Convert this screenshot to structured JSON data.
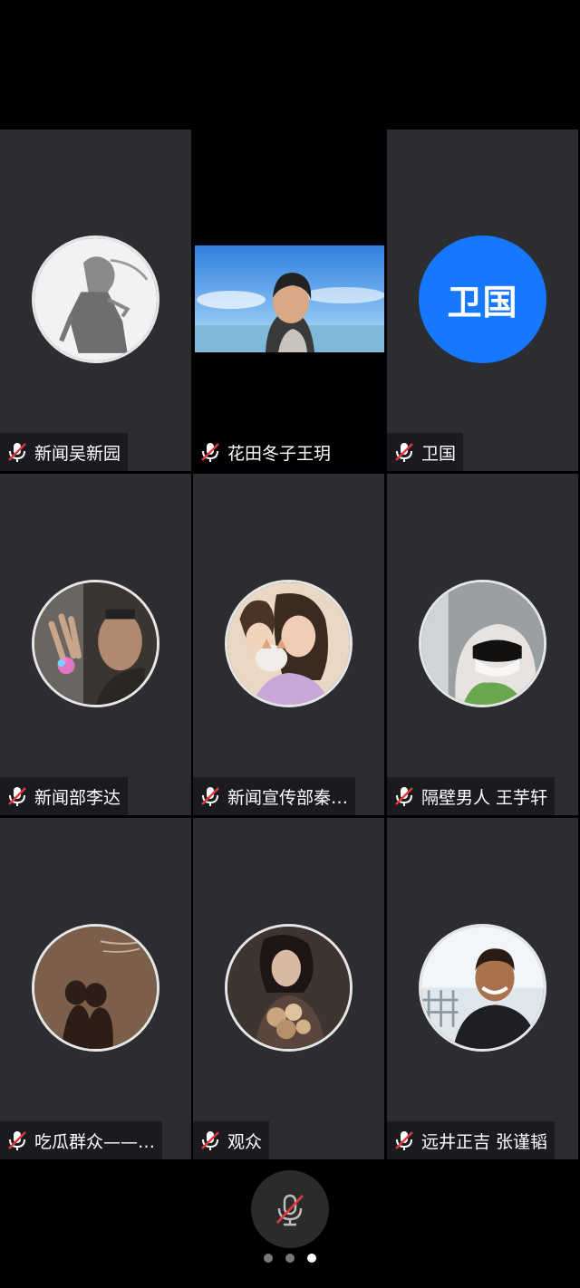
{
  "participants": [
    {
      "name": "新闻吴新园",
      "muted": true,
      "avatar": "sketch-portrait-avatar"
    },
    {
      "name": "花田冬子王玥",
      "muted": true,
      "avatar": "live-video-feed"
    },
    {
      "name": "卫国",
      "muted": true,
      "avatar_text": "卫国",
      "avatar_color": "#1677ff"
    },
    {
      "name": "新闻部李达",
      "muted": true,
      "avatar": "hand-glow-avatar"
    },
    {
      "name": "新闻宣传部秦…",
      "muted": true,
      "avatar": "girls-with-cat-avatar"
    },
    {
      "name": "隔壁男人 王芋轩",
      "muted": true,
      "avatar": "masked-hoodie-avatar"
    },
    {
      "name": "吃瓜群众——…",
      "muted": true,
      "avatar": "shadow-couple-avatar"
    },
    {
      "name": "观众",
      "muted": true,
      "avatar": "woman-flowers-avatar"
    },
    {
      "name": "远井正吉 张谨韬",
      "muted": true,
      "avatar": "smiling-man-avatar"
    }
  ],
  "controls": {
    "mic_muted": true,
    "mute_icon": "microphone-muted-icon"
  },
  "pager": {
    "pages": 3,
    "current_page": 3
  },
  "colors": {
    "tile_bg": "#2b2d31",
    "accent_blue": "#1677ff",
    "mute_red": "#e0393e"
  }
}
